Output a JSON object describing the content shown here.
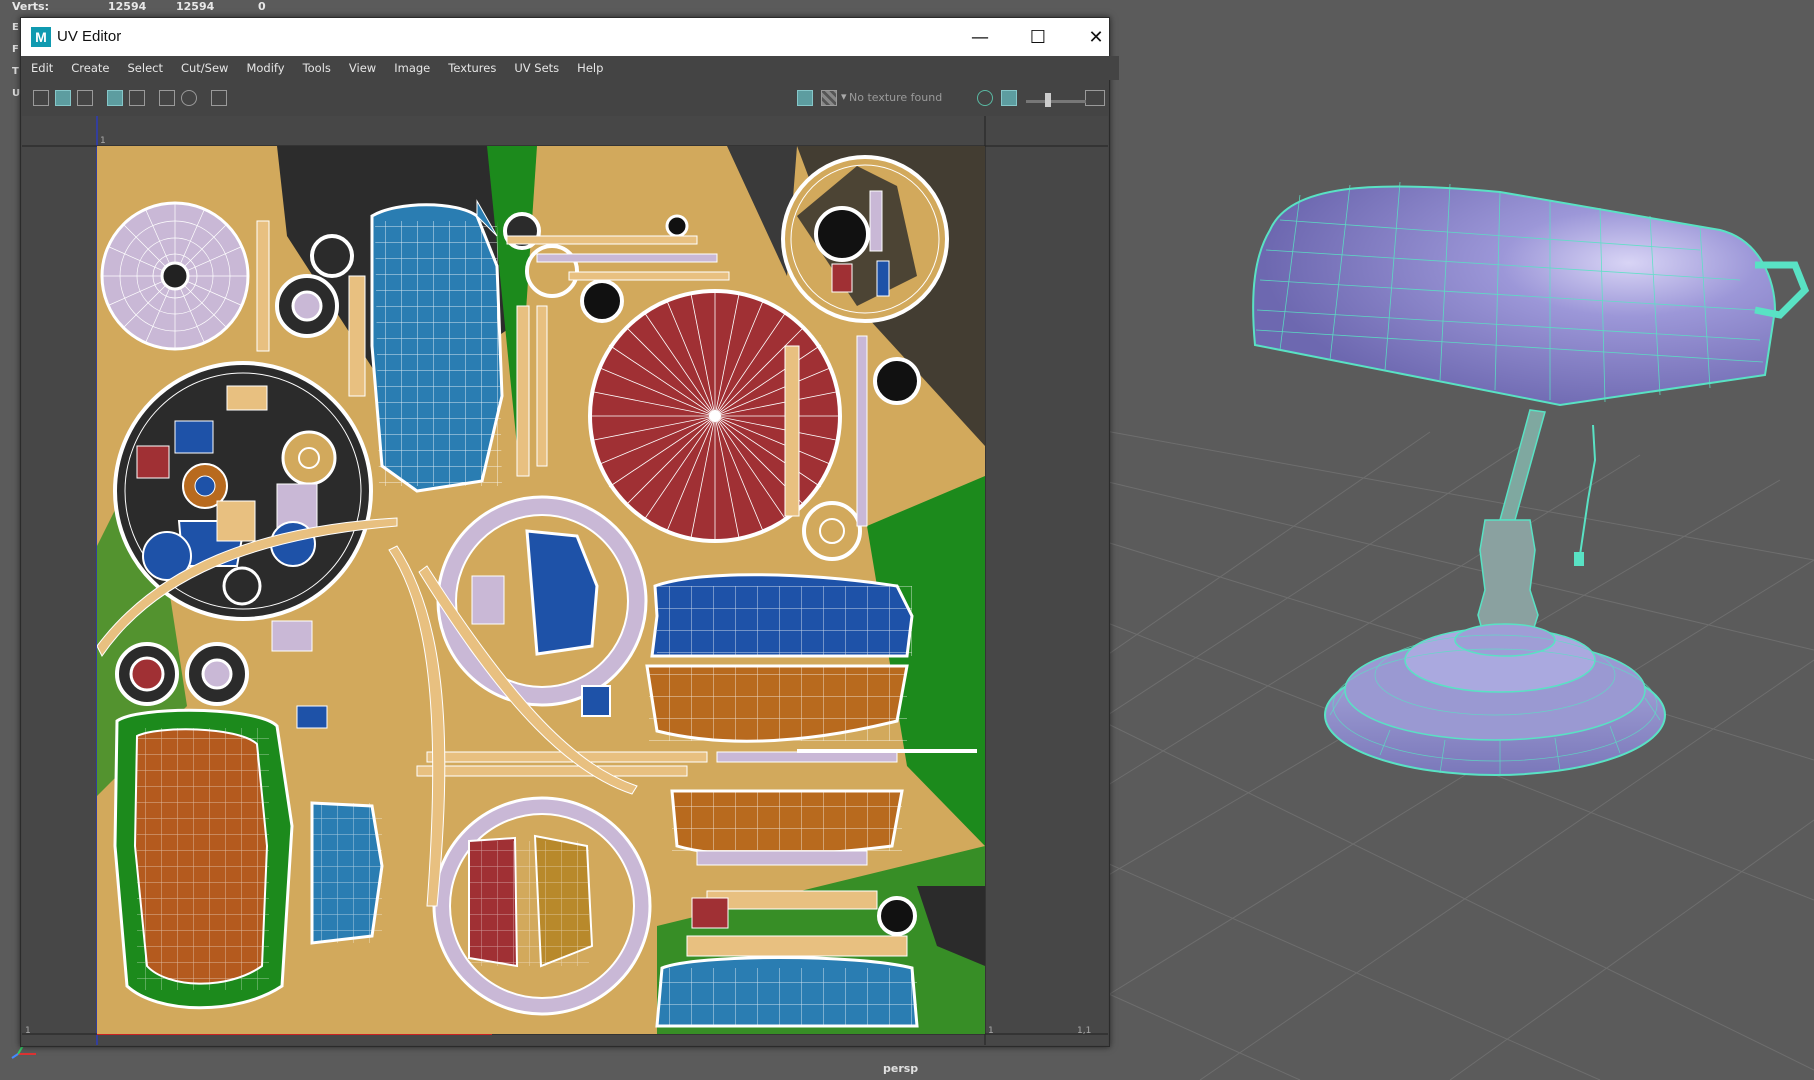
{
  "hud": {
    "verts_label": "Verts:",
    "verts_values": [
      "12594",
      "12594",
      "0"
    ],
    "side_letters": [
      "E",
      "F",
      "T",
      "U"
    ]
  },
  "viewport": {
    "camera_label": "persp"
  },
  "window": {
    "title": "UV Editor",
    "logo_letter": "M",
    "controls": {
      "minimize": "—",
      "maximize": "☐",
      "close": "✕"
    }
  },
  "menu": [
    "Edit",
    "Create",
    "Select",
    "Cut/Sew",
    "Modify",
    "Tools",
    "View",
    "Image",
    "Textures",
    "UV Sets",
    "Help"
  ],
  "toolbar": {
    "texture_status": "No texture found",
    "dropdown_arrow": "▾"
  },
  "uv_area": {
    "axis_labels": {
      "top_left": "1",
      "bottom_left": "1",
      "bottom_right_a": "1",
      "bottom_right_b": "1,1"
    }
  },
  "colors": {
    "uv_bg": "#d2a95c",
    "shell_red": "#a03034",
    "shell_blue": "#1e52a8",
    "shell_teal": "#2a7db2",
    "shell_orange": "#b86a1e",
    "shell_green": "#1c8a1c",
    "mesh_wire": "#59e2c4"
  }
}
